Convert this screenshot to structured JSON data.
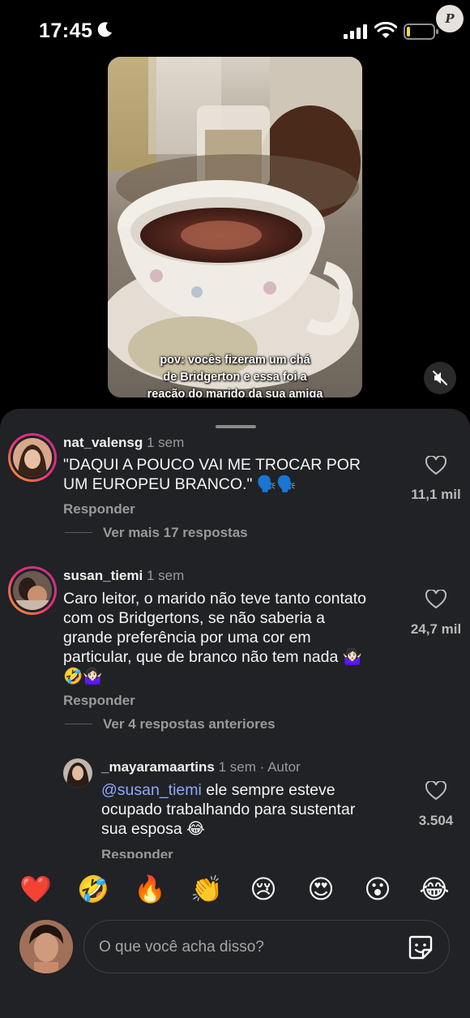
{
  "status_bar": {
    "time": "17:45",
    "focus_icon": "moon-icon",
    "signal_icon": "cellular-signal-icon",
    "wifi_icon": "wifi-icon",
    "battery_icon": "battery-icon",
    "watermark_letter": "P"
  },
  "video": {
    "caption_lines": [
      "pov: vocês fizeram um chá",
      "de Bridgerton e essa foi a",
      "reação do marido da sua amiga"
    ],
    "mute_icon": "speaker-muted-icon"
  },
  "comments": [
    {
      "username": "nat_valensg",
      "time": "1 sem",
      "text_lines": [
        "\"DAQUI A POUCO VAI ME TROCAR POR",
        "UM EUROPEU BRANCO.\" 🗣️🗣️"
      ],
      "likes": "11,1 mil",
      "reply_label": "Responder",
      "more_replies": "Ver mais 17 respostas"
    },
    {
      "username": "susan_tiemi",
      "time": "1 sem",
      "text_lines": [
        "Caro leitor, o marido não teve tanto contato",
        "com os Bridgertons, se não saberia a",
        "grande preferência por uma cor em",
        "particular, que de branco não tem nada 🤷🏻‍♀️",
        "🤣🤷🏻‍♀️"
      ],
      "likes": "24,7 mil",
      "reply_label": "Responder",
      "more_replies": "Ver 4 respostas anteriores"
    },
    {
      "username": "_mayaramaartins",
      "time": "1 sem",
      "author_tag": "· Autor",
      "mention": "@susan_tiemi",
      "text_lines": [
        " ele sempre esteve",
        "ocupado trabalhando para sustentar",
        "sua esposa 😂"
      ],
      "likes": "3.504",
      "reply_label": "Responder"
    }
  ],
  "reactions": [
    "❤️",
    "🤣",
    "🔥",
    "👏",
    "😢",
    "😍",
    "😮",
    "😂"
  ],
  "input": {
    "placeholder": "O que você acha disso?",
    "sticker_icon": "sticker-icon"
  }
}
